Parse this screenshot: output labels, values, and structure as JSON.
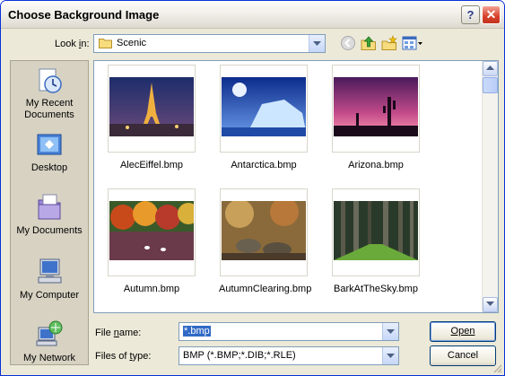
{
  "window": {
    "title": "Choose Background Image",
    "help_label": "?",
    "close_label": "✕"
  },
  "toolbar": {
    "look_in_label": "Look in:",
    "look_in_value": "Scenic",
    "icons": [
      "back-icon",
      "up-folder-icon",
      "new-folder-icon",
      "view-menu-icon"
    ]
  },
  "places": [
    {
      "name": "my-recent-documents",
      "label": "My Recent Documents"
    },
    {
      "name": "desktop",
      "label": "Desktop"
    },
    {
      "name": "my-documents",
      "label": "My Documents"
    },
    {
      "name": "my-computer",
      "label": "My Computer"
    },
    {
      "name": "my-network",
      "label": "My Network"
    }
  ],
  "files": [
    {
      "name": "AlecEiffel.bmp"
    },
    {
      "name": "Antarctica.bmp"
    },
    {
      "name": "Arizona.bmp"
    },
    {
      "name": "Autumn.bmp"
    },
    {
      "name": "AutumnClearing.bmp"
    },
    {
      "name": "BarkAtTheSky.bmp"
    }
  ],
  "form": {
    "file_name_label": "File name:",
    "file_name_value": "*.bmp",
    "files_of_type_label": "Files of type:",
    "files_of_type_value": "BMP (*.BMP;*.DIB;*.RLE)",
    "open_label": "Open",
    "cancel_label": "Cancel"
  },
  "colors": {
    "title_bar": "#f2f0ea",
    "accent": "#316ac5",
    "close": "#d7402a",
    "panel": "#ece9d8"
  }
}
